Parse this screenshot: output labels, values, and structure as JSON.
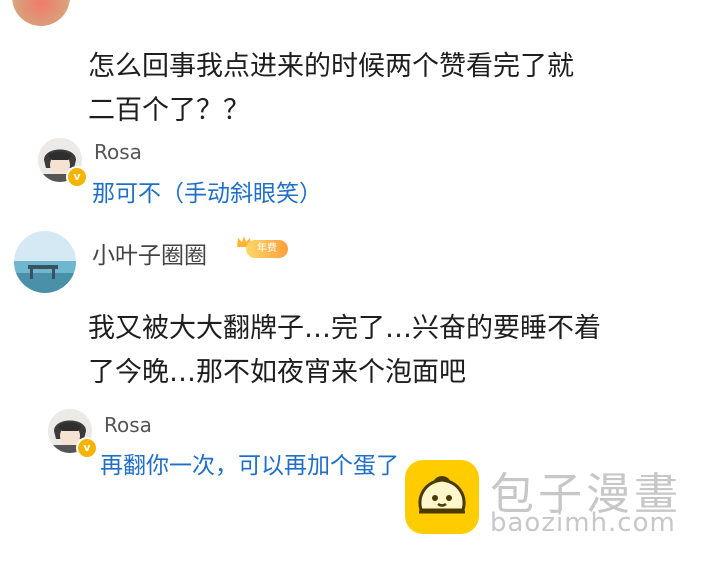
{
  "comments": [
    {
      "user": "",
      "text_lines": [
        "怎么回事我点进来的时候两个赞看完了就",
        "二百个了？？"
      ],
      "reply": {
        "user": "Rosa",
        "text": "那可不（手动斜眼笑）"
      }
    },
    {
      "user": "小叶子圈圈",
      "badge": "年费",
      "text_lines": [
        "我又被大大翻牌子…完了…兴奋的要睡不着",
        "了今晚…那不如夜宵来个泡面吧"
      ],
      "reply": {
        "user": "Rosa",
        "text": "再翻你一次，可以再加个蛋了"
      }
    }
  ],
  "watermark": {
    "brand": "包子漫畫",
    "url": "baozimh.com"
  },
  "colors": {
    "reply_link": "#1f6fc9",
    "badge": "#f5b400",
    "watermark_yellow": "#ffcc00"
  }
}
